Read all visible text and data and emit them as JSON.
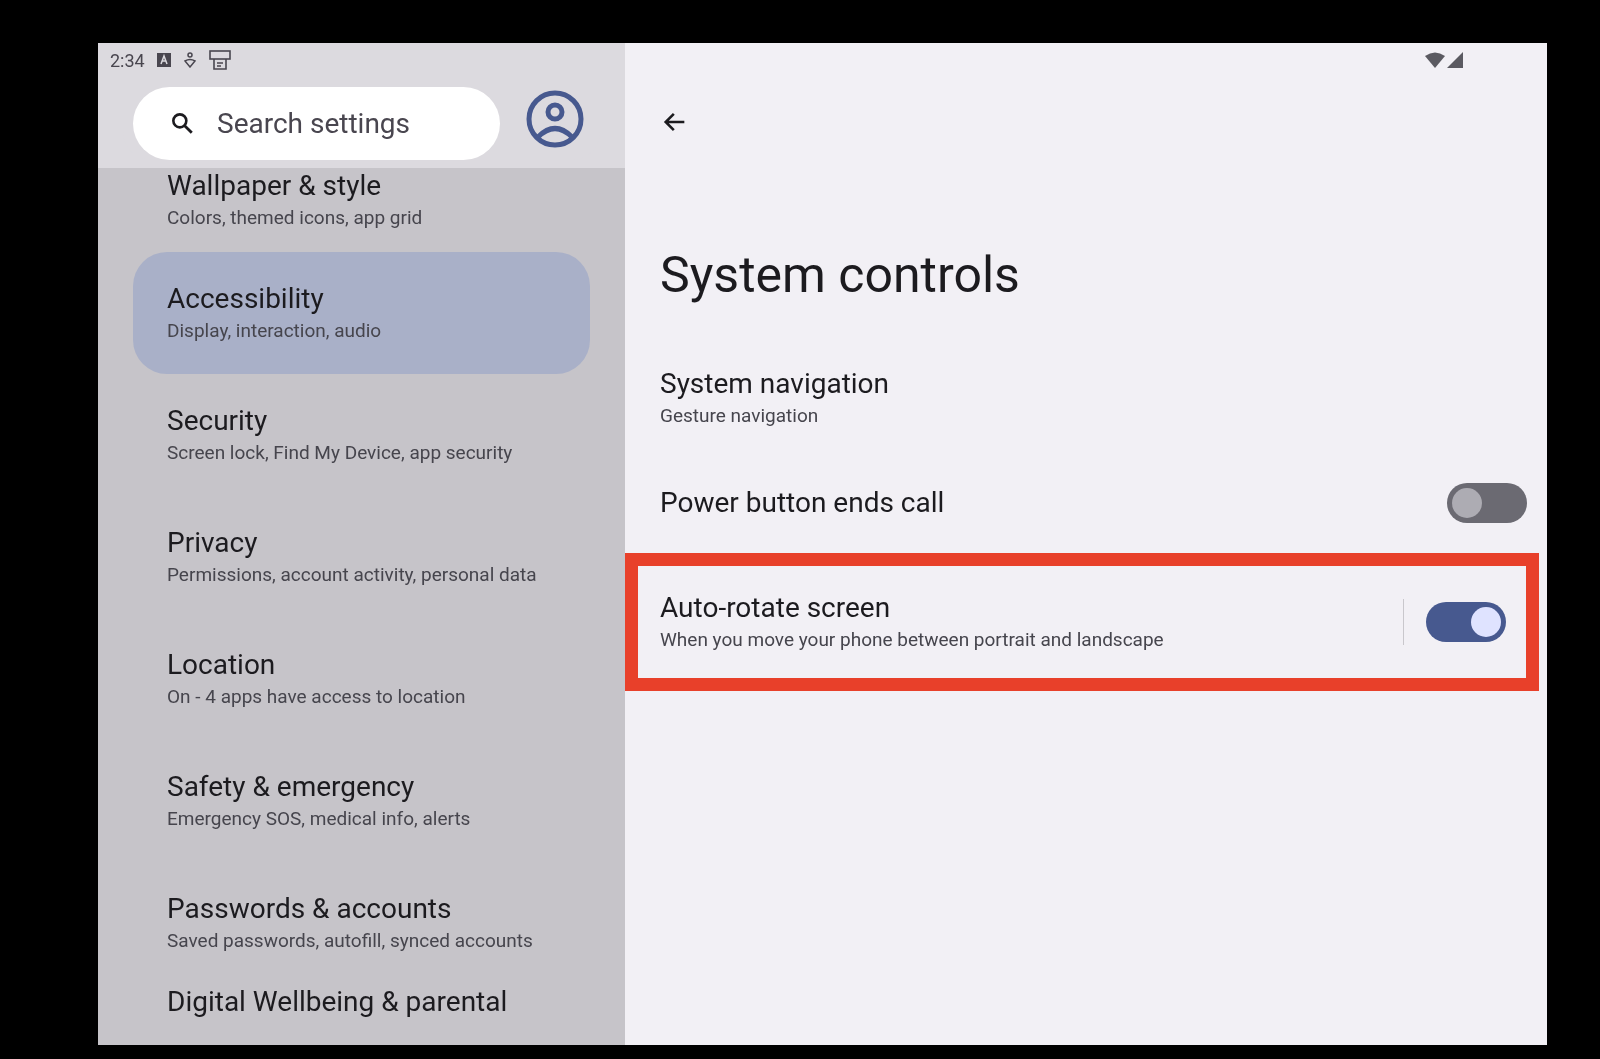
{
  "status_bar": {
    "time": "2:34"
  },
  "search": {
    "placeholder": "Search settings"
  },
  "sidebar": {
    "items": [
      {
        "title": "Wallpaper & style",
        "subtitle": "Colors, themed icons, app grid",
        "selected": false
      },
      {
        "title": "Accessibility",
        "subtitle": "Display, interaction, audio",
        "selected": true
      },
      {
        "title": "Security",
        "subtitle": "Screen lock, Find My Device, app security",
        "selected": false
      },
      {
        "title": "Privacy",
        "subtitle": "Permissions, account activity, personal data",
        "selected": false
      },
      {
        "title": "Location",
        "subtitle": "On - 4 apps have access to location",
        "selected": false
      },
      {
        "title": "Safety & emergency",
        "subtitle": "Emergency SOS, medical info, alerts",
        "selected": false
      },
      {
        "title": "Passwords & accounts",
        "subtitle": "Saved passwords, autofill, synced accounts",
        "selected": false
      },
      {
        "title": "Digital Wellbeing & parental",
        "selected": false
      }
    ]
  },
  "page": {
    "title": "System controls",
    "settings": [
      {
        "kind": "link",
        "title": "System navigation",
        "subtitle": "Gesture navigation"
      },
      {
        "kind": "toggle",
        "title": "Power button ends call",
        "on": false,
        "highlighted": false
      },
      {
        "kind": "toggle",
        "title": "Auto-rotate screen",
        "subtitle": "When you move your phone between portrait and landscape",
        "on": true,
        "highlighted": true
      }
    ]
  }
}
